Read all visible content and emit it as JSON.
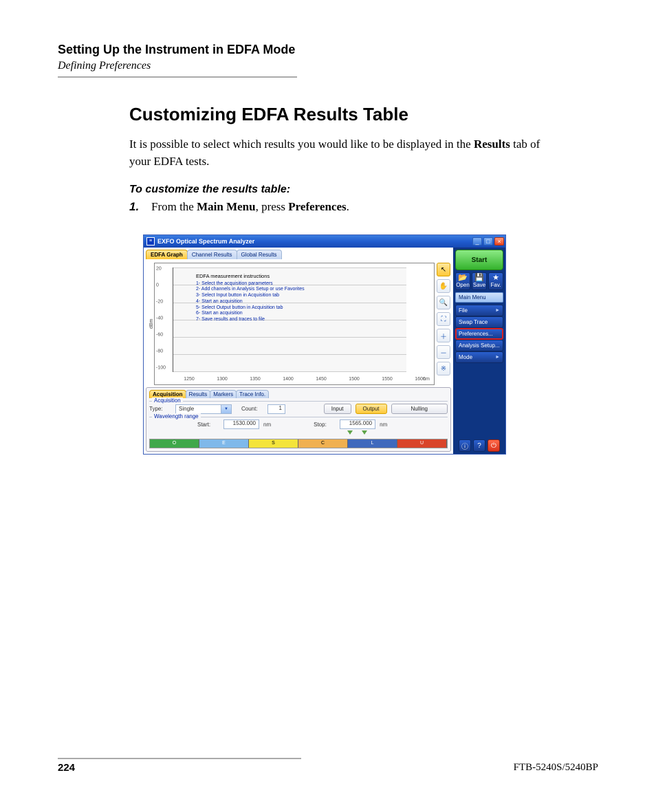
{
  "page": {
    "breadcrumb_title": "Setting Up the Instrument in EDFA Mode",
    "breadcrumb_sub": "Defining Preferences",
    "section_title": "Customizing EDFA Results Table",
    "intro_pre": "It is possible to select which results you would like to be displayed in the ",
    "intro_bold": "Results",
    "intro_post": " tab of your EDFA tests.",
    "instruct_lead": "To customize the results table:",
    "step1_num": "1.",
    "step1_pre": "From the ",
    "step1_b1": "Main Menu",
    "step1_mid": ", press ",
    "step1_b2": "Preferences",
    "step1_post": ".",
    "footer_page": "224",
    "footer_model": "FTB-5240S/5240BP"
  },
  "app": {
    "title": "EXFO Optical Spectrum Analyzer",
    "top_tabs": [
      "EDFA Graph",
      "Channel Results",
      "Global Results"
    ],
    "y_label": "dBm",
    "y_ticks": [
      "20",
      "0",
      "-20",
      "-40",
      "-60",
      "-80",
      "-100"
    ],
    "x_ticks": [
      "1250",
      "1300",
      "1350",
      "1400",
      "1450",
      "1500",
      "1550",
      "1600"
    ],
    "x_unit": "nm",
    "instr_title": "EDFA measurement instructions",
    "instr_lines": [
      "1- Select the acquisition parameters",
      "2- Add channels in Analysis Setup or use Favorites",
      "3- Select Input button in Acquisition tab",
      "4- Start an acquisition",
      "5- Select Output button in Acquisition tab",
      "6- Start an acquisition",
      "7- Save results and traces to file"
    ],
    "bottom_tabs": [
      "Acquisition",
      "Results",
      "Markers",
      "Trace Info."
    ],
    "acq_legend": "Acquisition",
    "type_label": "Type:",
    "type_value": "Single",
    "count_label": "Count:",
    "count_value": "1",
    "input_btn": "Input",
    "output_btn": "Output",
    "nulling_btn": "Nulling",
    "wrange_legend": "Wavelength range",
    "start_label": "Start:",
    "start_value": "1530.000",
    "stop_label": "Stop:",
    "stop_value": "1565.000",
    "bands": [
      {
        "name": "O",
        "color": "#3fa84a"
      },
      {
        "name": "E",
        "color": "#7fb9ea"
      },
      {
        "name": "S",
        "color": "#f4e43a"
      },
      {
        "name": "C",
        "color": "#f0b050"
      },
      {
        "name": "L",
        "color": "#3f69bd"
      },
      {
        "name": "U",
        "color": "#d9442a"
      }
    ],
    "start_btn": "Start",
    "icon_open": "Open",
    "icon_save": "Save",
    "icon_fav": "Fav.",
    "menu_head": "Main Menu",
    "menu_items": [
      "File",
      "Swap Trace",
      "Preferences...",
      "Analysis Setup...",
      "Mode"
    ],
    "menu_arrow_indices": [
      0,
      4
    ],
    "menu_highlight_index": 2
  }
}
